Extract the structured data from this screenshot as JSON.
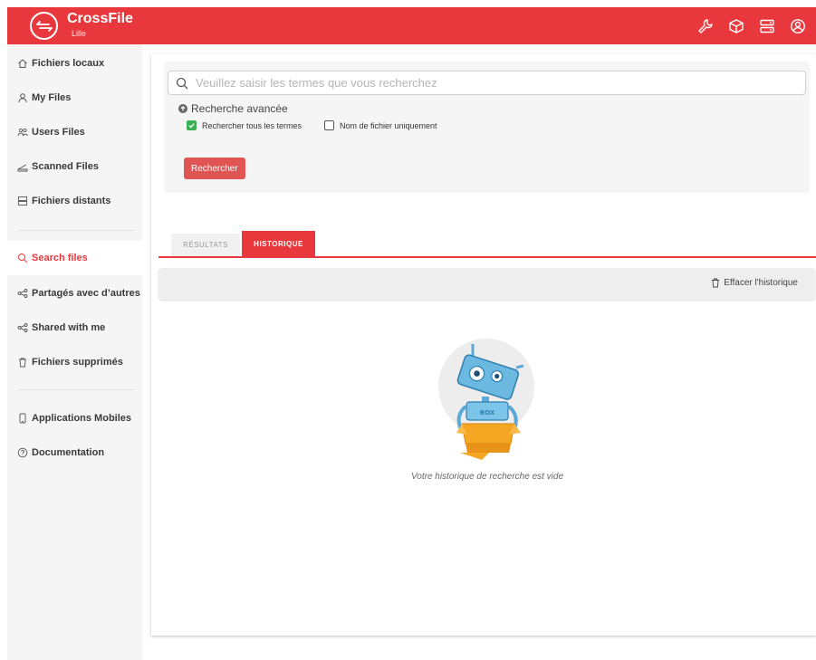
{
  "app": {
    "name": "CrossFile",
    "subtitle": "Lille"
  },
  "header_icons": [
    "wrench-icon",
    "cube-icon",
    "server-icon",
    "account-icon"
  ],
  "sidebar": {
    "items": [
      {
        "label": "Fichiers locaux",
        "icon": "home-icon"
      },
      {
        "label": "My Files",
        "icon": "user-icon"
      },
      {
        "label": "Users Files",
        "icon": "users-icon"
      },
      {
        "label": "Scanned Files",
        "icon": "scanner-icon"
      },
      {
        "label": "Fichiers distants",
        "icon": "server-icon"
      },
      {
        "label": "Search files",
        "icon": "search-icon",
        "active": true
      },
      {
        "label": "Partagés avec d’autres",
        "icon": "share-icon"
      },
      {
        "label": "Shared with me",
        "icon": "share-icon"
      },
      {
        "label": "Fichiers supprimés",
        "icon": "trash-icon"
      },
      {
        "label": "Applications Mobiles",
        "icon": "phone-icon"
      },
      {
        "label": "Documentation",
        "icon": "help-icon"
      }
    ]
  },
  "search": {
    "placeholder": "Veuillez saisir les termes que vous recherchez",
    "value": "",
    "advanced_label": "Recherche avancée",
    "option_all_terms": {
      "label": "Rechercher tous les termes",
      "checked": true
    },
    "option_filename_only": {
      "label": "Nom de fichier uniquement",
      "checked": false
    },
    "submit_label": "Rechercher"
  },
  "tabs": [
    {
      "label": "RÉSULTATS",
      "active": false
    },
    {
      "label": "HISTORIQUE",
      "active": true
    }
  ],
  "history": {
    "clear_label": "Effacer l'historique",
    "empty_message": "Votre historique de recherche est vide",
    "illustration_text": "BOX"
  },
  "colors": {
    "brand": "#e8383d",
    "button": "#e05454",
    "checkbox_on": "#3cb054"
  }
}
